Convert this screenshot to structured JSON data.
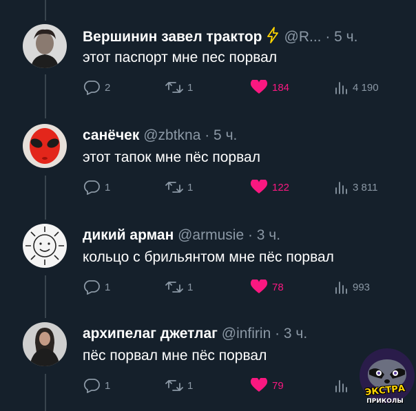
{
  "tweets": [
    {
      "name": "Вершинин завел трактор",
      "meta": "@R... · 5 ч.",
      "text": "этот паспорт мне пес порвал",
      "replies": "2",
      "retweets": "1",
      "likes": "184",
      "views": "4 190",
      "avatar_icon": "man-portrait-avatar",
      "verified": true
    },
    {
      "name": "санёчек",
      "meta": "@zbtkna · 5 ч.",
      "text": "этот тапок мне пёс порвал",
      "replies": "1",
      "retweets": "1",
      "likes": "122",
      "views": "3 811",
      "avatar_icon": "red-alien-avatar",
      "verified": false
    },
    {
      "name": "дикий арман",
      "meta": "@armusie · 3 ч.",
      "text": "кольцо с брильянтом мне пёс порвал",
      "replies": "1",
      "retweets": "1",
      "likes": "78",
      "views": "993",
      "avatar_icon": "sun-face-avatar",
      "verified": false
    },
    {
      "name": "архипелаг джетлаг",
      "meta": "@infirin · 3 ч.",
      "text": "пёс порвал мне пёс порвал",
      "replies": "1",
      "retweets": "1",
      "likes": "79",
      "views": "",
      "avatar_icon": "woman-portrait-avatar",
      "verified": false
    }
  ],
  "watermark": {
    "title": "ЭКСТРА",
    "subtitle": "ПРИКОЛЫ"
  },
  "colors": {
    "background": "#15202b",
    "muted": "#8b98a5",
    "like": "#f91880",
    "verified": "#ffd400"
  }
}
